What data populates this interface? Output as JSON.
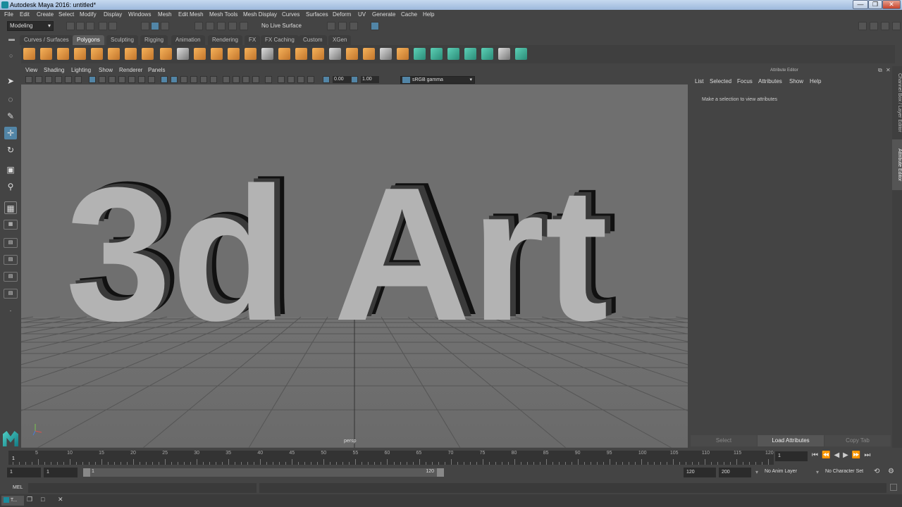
{
  "window": {
    "title": "Autodesk Maya 2016: untitled*",
    "min": "—",
    "max": "❐",
    "close": "✕"
  },
  "menu": [
    "File",
    "Edit",
    "Create",
    "Select",
    "Modify",
    "Display",
    "Windows",
    "Mesh",
    "Edit Mesh",
    "Mesh Tools",
    "Mesh Display",
    "Curves",
    "Surfaces",
    "Deform",
    "UV",
    "Generate",
    "Cache",
    "Help"
  ],
  "status": {
    "mode": "Modeling",
    "live_surface": "No Live Surface"
  },
  "shelf_tabs": [
    "Curves / Surfaces",
    "Polygons",
    "Sculpting",
    "Rigging",
    "Animation",
    "Rendering",
    "FX",
    "FX Caching",
    "Custom",
    "XGen"
  ],
  "active_shelf": "Polygons",
  "viewport": {
    "menu": [
      "View",
      "Shading",
      "Lighting",
      "Show",
      "Renderer",
      "Panels"
    ],
    "exposure": "0.00",
    "gamma": "1.00",
    "color_space": "sRGB gamma",
    "scene_text": "3d Art",
    "camera": "persp"
  },
  "attribute_editor": {
    "title": "Attribute Editor",
    "menu": [
      "List",
      "Selected",
      "Focus",
      "Attributes",
      "Show",
      "Help"
    ],
    "message": "Make a selection to view attributes",
    "buttons": [
      "Select",
      "Load Attributes",
      "Copy Tab"
    ]
  },
  "side_tabs": [
    "Channel Box / Layer Editor",
    "Attribute Editor"
  ],
  "timeline": {
    "ticks": [
      "5",
      "10",
      "15",
      "20",
      "25",
      "30",
      "35",
      "40",
      "45",
      "50",
      "55",
      "60",
      "65",
      "70",
      "75",
      "80",
      "85",
      "90",
      "95",
      "100",
      "105",
      "110",
      "115",
      "120"
    ],
    "start_label": "1",
    "current_frame": "1"
  },
  "range": {
    "start": "1",
    "playback_start": "1",
    "slider_start": "1",
    "slider_end": "120",
    "playback_end": "120",
    "end": "200",
    "anim_layer": "No Anim Layer",
    "character_set": "No Character Set"
  },
  "command_line": {
    "label": "MEL"
  },
  "taskbar": {
    "item": "T..."
  }
}
